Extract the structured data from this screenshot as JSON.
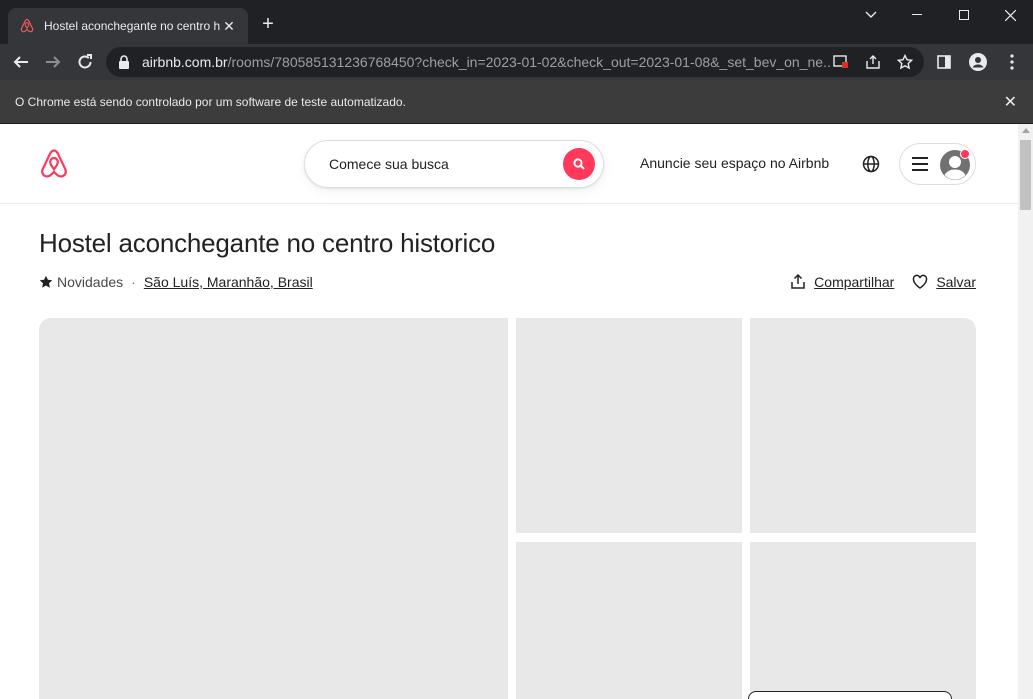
{
  "browser": {
    "tab_title": "Hostel aconchegante no centro h",
    "url_host": "airbnb.com.br",
    "url_rest": "/rooms/780585131236768450?check_in=2023-01-02&check_out=2023-01-08&_set_bev_on_ne...",
    "infobar_text": "O Chrome está sendo controlado por um software de teste automatizado."
  },
  "header": {
    "search_placeholder": "Comece sua busca",
    "host_link": "Anuncie seu espaço no Airbnb"
  },
  "listing": {
    "title": "Hostel aconchegante no centro historico",
    "rating_label": "Novidades",
    "separator": "·",
    "location": "São Luís, Maranhão, Brasil",
    "share_label": "Compartilhar",
    "save_label": "Salvar"
  },
  "colors": {
    "brand": "#ff385c",
    "placeholder": "#e8e8e8"
  },
  "icons": {
    "logo": "airbnb-logo-icon",
    "search": "search-icon",
    "globe": "globe-icon",
    "menu": "hamburger-icon",
    "avatar": "avatar-icon",
    "share": "share-icon",
    "heart": "heart-icon",
    "star": "star-icon"
  }
}
